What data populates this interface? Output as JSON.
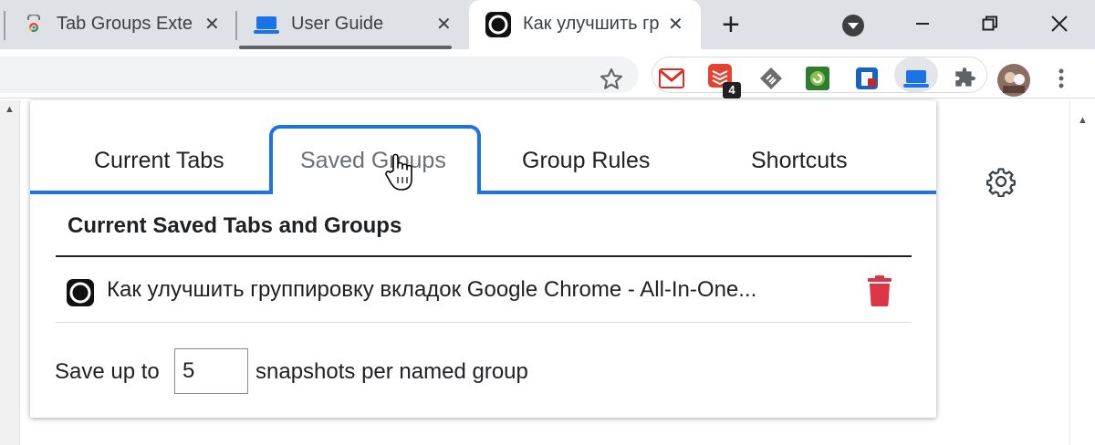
{
  "browser": {
    "tabs": [
      {
        "title": "Tab Groups Exten",
        "icon": "chrome-web-store-icon",
        "close": "✕"
      },
      {
        "title": "User Guide",
        "icon": "laptop-icon",
        "close": "✕"
      },
      {
        "title": "Как улучшить гр",
        "icon": "circle-logo-icon",
        "close": "✕",
        "active": true
      }
    ],
    "new_tab": "+",
    "window_controls": [
      "minimize",
      "restore",
      "close"
    ],
    "extensions": [
      {
        "name": "gmail-icon"
      },
      {
        "name": "todoist-icon",
        "badge": "4"
      },
      {
        "name": "feedly-icon"
      },
      {
        "name": "refresh-icon"
      },
      {
        "name": "lock-icon"
      },
      {
        "name": "tab-groups-extension-icon",
        "active": true
      },
      {
        "name": "puzzle-icon"
      },
      {
        "name": "avatar"
      },
      {
        "name": "menu-icon"
      }
    ],
    "colors": {
      "accent": "#1a73e8",
      "delete": "#d93025"
    }
  },
  "popup": {
    "tabs": [
      {
        "label": "Current Tabs"
      },
      {
        "label": "Saved Groups",
        "selected": true
      },
      {
        "label": "Group Rules"
      },
      {
        "label": "Shortcuts"
      }
    ],
    "section_title": "Current Saved Tabs and Groups",
    "saved_items": [
      {
        "title": "Как улучшить группировку вкладок Google Chrome - All-In-One..."
      }
    ],
    "snapshots": {
      "prefix": "Save up to",
      "value": "5",
      "suffix": "snapshots per named group"
    }
  }
}
